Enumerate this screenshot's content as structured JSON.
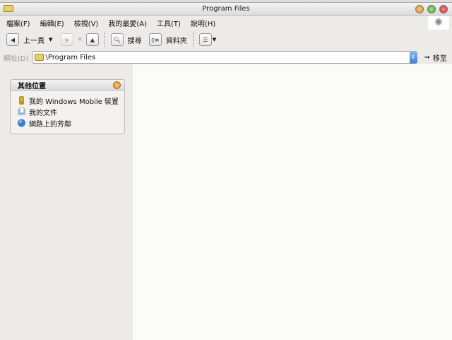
{
  "window": {
    "title": "Program Files"
  },
  "menu": [
    {
      "label": "檔案(F)"
    },
    {
      "label": "編輯(E)"
    },
    {
      "label": "檢視(V)"
    },
    {
      "label": "我的最愛(A)"
    },
    {
      "label": "工具(T)"
    },
    {
      "label": "說明(H)"
    }
  ],
  "toolbar": {
    "back": "上一頁",
    "search": "搜尋",
    "folders": "資料夾"
  },
  "address": {
    "label": "網址(D)",
    "value": "\\Program Files",
    "go": "移至"
  },
  "panel": {
    "title": "其他位置",
    "items": [
      {
        "label": "我的 Windows Mobile 裝置",
        "icon": "mobile-device-icon"
      },
      {
        "label": "我的文件",
        "icon": "documents-icon"
      },
      {
        "label": "網路上的芳鄰",
        "icon": "network-icon"
      }
    ]
  }
}
